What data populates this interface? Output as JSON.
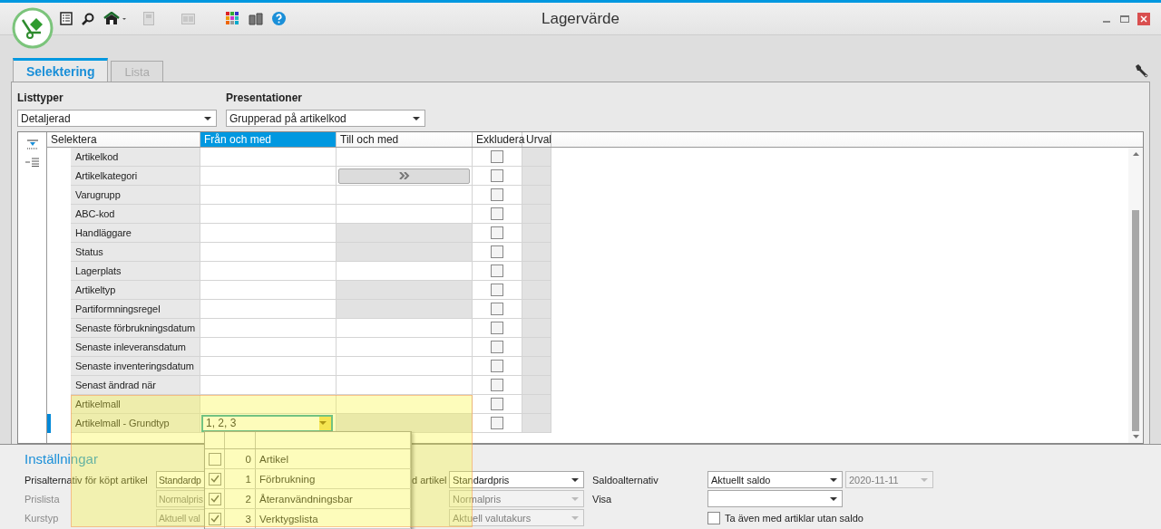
{
  "window": {
    "title": "Lagervärde"
  },
  "tabs": [
    {
      "label": "Selektering",
      "selected": true
    },
    {
      "label": "Lista",
      "selected": false
    }
  ],
  "filters": [
    {
      "label": "Listtyper",
      "value": "Detaljerad"
    },
    {
      "label": "Presentationer",
      "value": "Grupperad på artikelkod"
    }
  ],
  "grid": {
    "columns": [
      {
        "label": "Selektera",
        "selected": false
      },
      {
        "label": "Från och med",
        "selected": true
      },
      {
        "label": "Till och med",
        "selected": false
      },
      {
        "label": "Exkludera",
        "selected": false
      },
      {
        "label": "Urval",
        "selected": false
      }
    ],
    "rows": [
      {
        "label": "Artikelkod",
        "kind": "field",
        "till_disabled": false,
        "excluded": false,
        "selected": false
      },
      {
        "label": "Artikelkategori",
        "kind": "button",
        "till_disabled": false,
        "excluded": false,
        "selected": false
      },
      {
        "label": "Varugrupp",
        "kind": "field",
        "till_disabled": false,
        "excluded": false,
        "selected": false
      },
      {
        "label": "ABC-kod",
        "kind": "field",
        "till_disabled": false,
        "excluded": false,
        "selected": false
      },
      {
        "label": "Handläggare",
        "kind": "field",
        "till_disabled": true,
        "excluded": false,
        "selected": false
      },
      {
        "label": "Status",
        "kind": "field",
        "till_disabled": true,
        "excluded": false,
        "selected": false
      },
      {
        "label": "Lagerplats",
        "kind": "field",
        "till_disabled": false,
        "excluded": false,
        "selected": false
      },
      {
        "label": "Artikeltyp",
        "kind": "field",
        "till_disabled": true,
        "excluded": false,
        "selected": false
      },
      {
        "label": "Partiformningsregel",
        "kind": "field",
        "till_disabled": true,
        "excluded": false,
        "selected": false
      },
      {
        "label": "Senaste förbrukningsdatum",
        "kind": "field",
        "till_disabled": false,
        "excluded": false,
        "selected": false
      },
      {
        "label": "Senaste inleveransdatum",
        "kind": "field",
        "till_disabled": false,
        "excluded": false,
        "selected": false
      },
      {
        "label": "Senaste inventeringsdatum",
        "kind": "field",
        "till_disabled": false,
        "excluded": false,
        "selected": false
      },
      {
        "label": "Senast ändrad när",
        "kind": "field",
        "till_disabled": false,
        "excluded": false,
        "selected": false
      },
      {
        "label": "Artikelmall",
        "kind": "field",
        "till_disabled": false,
        "excluded": false,
        "selected": false
      },
      {
        "label": "Artikelmall - Grundtyp",
        "from_value": "1, 2, 3",
        "kind": "field",
        "till_disabled": true,
        "excluded": false,
        "selected": true
      }
    ]
  },
  "dropdown": {
    "items": [
      {
        "checked": false,
        "code": "0",
        "name": "Artikel"
      },
      {
        "checked": true,
        "code": "1",
        "name": "Förbrukning"
      },
      {
        "checked": true,
        "code": "2",
        "name": "Återanvändningsbar"
      },
      {
        "checked": true,
        "code": "3",
        "name": "Verktygslista"
      }
    ]
  },
  "highlight_overlay": true,
  "settings": {
    "title": "Inställningar",
    "rows": [
      {
        "label": {
          "text": "Prisalternativ för köpt artikel",
          "disabled": false
        },
        "select_1": {
          "value": "Standardp",
          "disabled": false
        },
        "label_2": "d artikel",
        "select_2": {
          "value": "Standardpris",
          "disabled": false
        },
        "label_3": "Saldoalternativ",
        "select_3": {
          "value": "Aktuellt saldo",
          "disabled": false
        },
        "date": {
          "value": "2020-11-11",
          "disabled": true
        }
      },
      {
        "label": {
          "text": "Prislista",
          "disabled": true
        },
        "select_1": {
          "value": "Normalpris",
          "disabled": true
        },
        "select_2": {
          "value": "Normalpris",
          "disabled": true
        },
        "label_3": "Visa",
        "select_3": {
          "disabled": false
        }
      },
      {
        "label": {
          "text": "Kurstyp",
          "disabled": true
        },
        "select_1": {
          "value": "Aktuell val",
          "disabled": true
        },
        "select_2": {
          "value": "Aktuell valutakurs",
          "disabled": true
        },
        "checkbox": {
          "label": "Ta även med artiklar utan saldo",
          "checked": false
        }
      }
    ]
  }
}
